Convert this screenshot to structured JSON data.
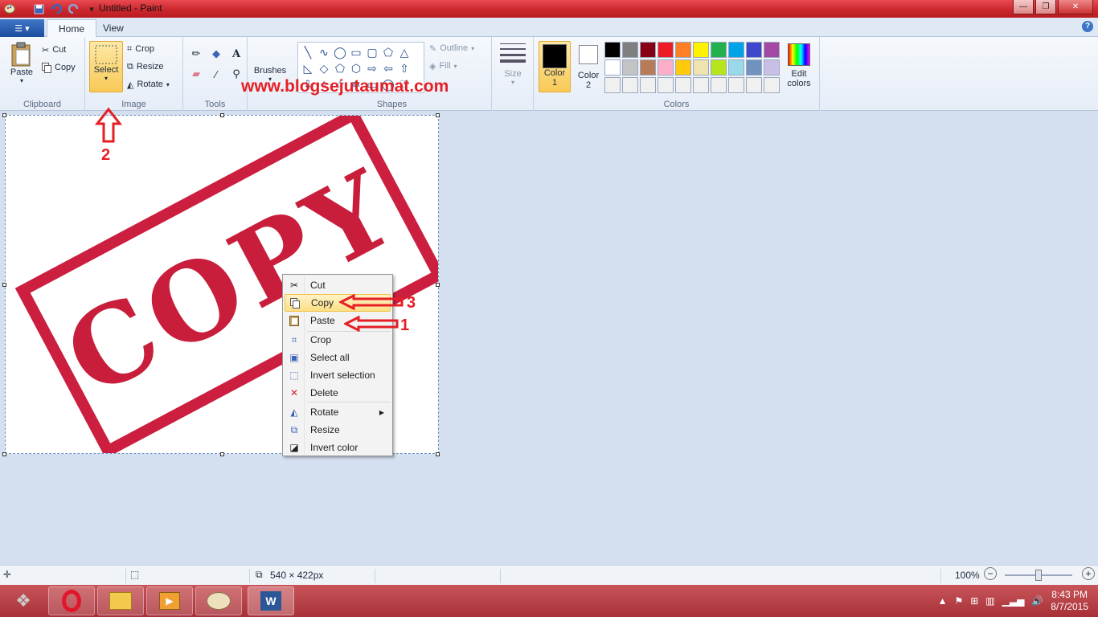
{
  "titlebar": {
    "title": "Untitled - Paint",
    "qa_icons": [
      "save-icon",
      "undo-icon",
      "redo-icon",
      "dropdown-icon"
    ],
    "window_controls": [
      "minimize",
      "maximize",
      "close"
    ]
  },
  "tabs": {
    "file_icon": "paint-menu-icon",
    "items": [
      "Home",
      "View"
    ],
    "active": "Home"
  },
  "ribbon": {
    "clipboard": {
      "label": "Clipboard",
      "paste": "Paste",
      "cut": "Cut",
      "copy": "Copy"
    },
    "image": {
      "label": "Image",
      "select": "Select",
      "crop": "Crop",
      "resize": "Resize",
      "rotate": "Rotate"
    },
    "tools": {
      "label": "Tools"
    },
    "brushes": {
      "label": "Brushes"
    },
    "shapes": {
      "label": "Shapes",
      "outline": "Outline",
      "fill": "Fill"
    },
    "size": {
      "label": "Size"
    },
    "colors": {
      "label": "Colors",
      "color1_line1": "Color",
      "color1_line2": "1",
      "color2_line1": "Color",
      "color2_line2": "2",
      "edit_line1": "Edit",
      "edit_line2": "colors",
      "palette": [
        "#000000",
        "#7f7f7f",
        "#880015",
        "#ed1c24",
        "#ff7f27",
        "#fff200",
        "#22b14c",
        "#00a2e8",
        "#3f48cc",
        "#a349a4",
        "#ffffff",
        "#c3c3c3",
        "#b97a57",
        "#ffaec9",
        "#ffc90e",
        "#efe4b0",
        "#b5e61d",
        "#99d9ea",
        "#7092be",
        "#c8bfe7",
        "#f0f0f0",
        "#f0f0f0",
        "#f0f0f0",
        "#f0f0f0",
        "#f0f0f0",
        "#f0f0f0",
        "#f0f0f0",
        "#f0f0f0",
        "#f0f0f0",
        "#f0f0f0"
      ]
    }
  },
  "watermark": "www.blogsejutaumat.com",
  "canvas": {
    "stamp_text": "COPY"
  },
  "annotations": {
    "a1": "1",
    "a2": "2",
    "a3": "3"
  },
  "context_menu": {
    "items": [
      {
        "label": "Cut",
        "icon": "scissors-icon"
      },
      {
        "label": "Copy",
        "icon": "copy-icon"
      },
      {
        "label": "Paste",
        "icon": "paste-icon"
      },
      {
        "label": "Crop",
        "icon": "crop-icon"
      },
      {
        "label": "Select all",
        "icon": "select-all-icon"
      },
      {
        "label": "Invert selection",
        "icon": "invert-selection-icon"
      },
      {
        "label": "Delete",
        "icon": "delete-icon"
      },
      {
        "label": "Rotate",
        "icon": "rotate-icon"
      },
      {
        "label": "Resize",
        "icon": "resize-icon"
      },
      {
        "label": "Invert color",
        "icon": "invert-color-icon"
      }
    ],
    "highlighted": "Copy"
  },
  "statusbar": {
    "dimensions": "540 × 422px",
    "zoom": "100%"
  },
  "taskbar": {
    "apps": [
      "Opera",
      "File Explorer",
      "Media Player",
      "Paint",
      "Word"
    ],
    "time": "8:43 PM",
    "date": "8/7/2015"
  },
  "colors": {
    "accent_red": "#e61e25",
    "stamp_red": "#c81e3c"
  }
}
